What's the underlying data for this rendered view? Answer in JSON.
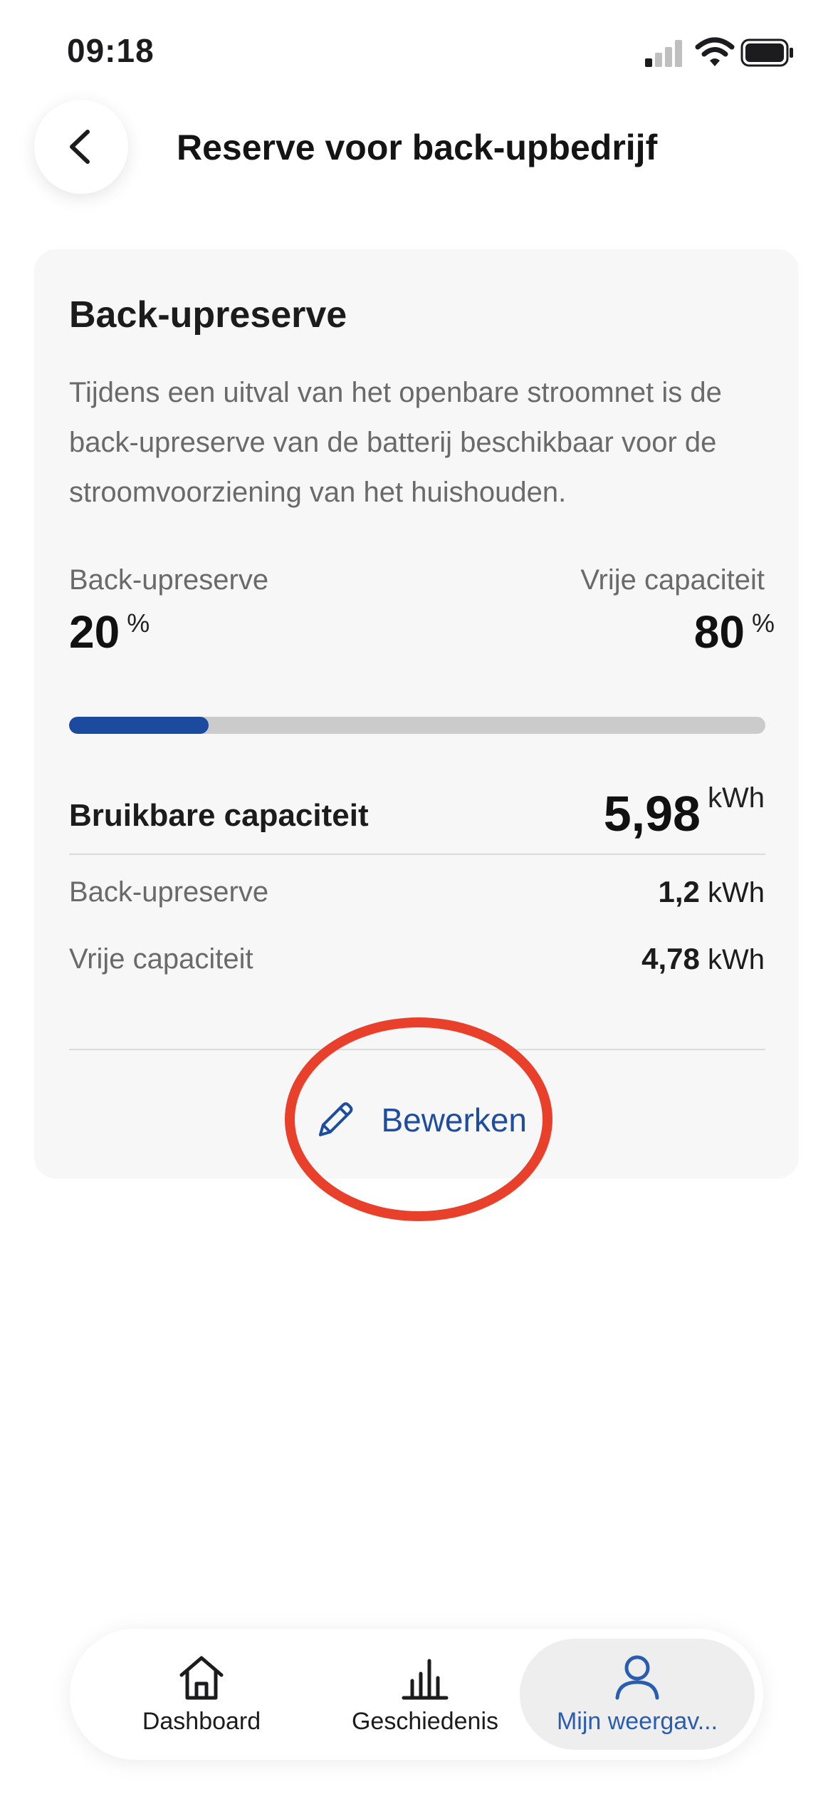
{
  "status_bar": {
    "time": "09:18"
  },
  "header": {
    "title": "Reserve voor back-upbedrijf"
  },
  "card": {
    "title": "Back-upreserve",
    "description": "Tijdens een uitval van het openbare stroomnet is de back-upreserve van de batterij beschikbaar voor de stroomvoorziening van het huishouden.",
    "backup_label": "Back-upreserve",
    "backup_value": "20",
    "backup_unit": "%",
    "free_label": "Vrije capaciteit",
    "free_value": "80",
    "free_unit": "%",
    "progress_fraction": 0.2,
    "usable_label": "Bruikbare capaciteit",
    "usable_value": "5,98",
    "usable_unit": "kWh",
    "rows": [
      {
        "label": "Back-upreserve",
        "value": "1,2",
        "unit": "kWh"
      },
      {
        "label": "Vrije capaciteit",
        "value": "4,78",
        "unit": "kWh"
      }
    ],
    "edit_label": "Bewerken"
  },
  "bottom_nav": {
    "items": [
      {
        "label": "Dashboard",
        "icon": "home-icon",
        "active": false
      },
      {
        "label": "Geschiedenis",
        "icon": "bar-chart-icon",
        "active": false
      },
      {
        "label": "Mijn weergav...",
        "icon": "user-icon",
        "active": true
      }
    ]
  },
  "colors": {
    "accent": "#1b4a9e",
    "highlight": "#e8402a",
    "active_nav": "#2a5db0"
  }
}
